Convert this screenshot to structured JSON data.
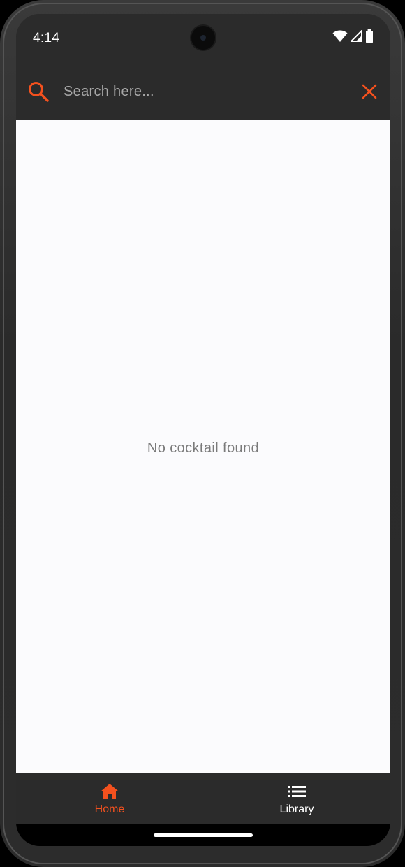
{
  "status_bar": {
    "time": "4:14",
    "icons": [
      "wifi-icon",
      "cell-signal-icon",
      "battery-icon"
    ]
  },
  "search": {
    "placeholder": "Search here...",
    "value": "",
    "search_icon": "search-icon",
    "clear_icon": "close-icon"
  },
  "main": {
    "empty_message": "No cocktail found"
  },
  "bottom_nav": {
    "items": [
      {
        "label": "Home",
        "icon": "home-icon",
        "selected": true
      },
      {
        "label": "Library",
        "icon": "list-icon",
        "selected": false
      }
    ]
  },
  "colors": {
    "accent": "#f4511e",
    "bar_background": "#2b2b2b",
    "content_background": "#fbfbfd",
    "empty_text": "#7a7a7a"
  }
}
